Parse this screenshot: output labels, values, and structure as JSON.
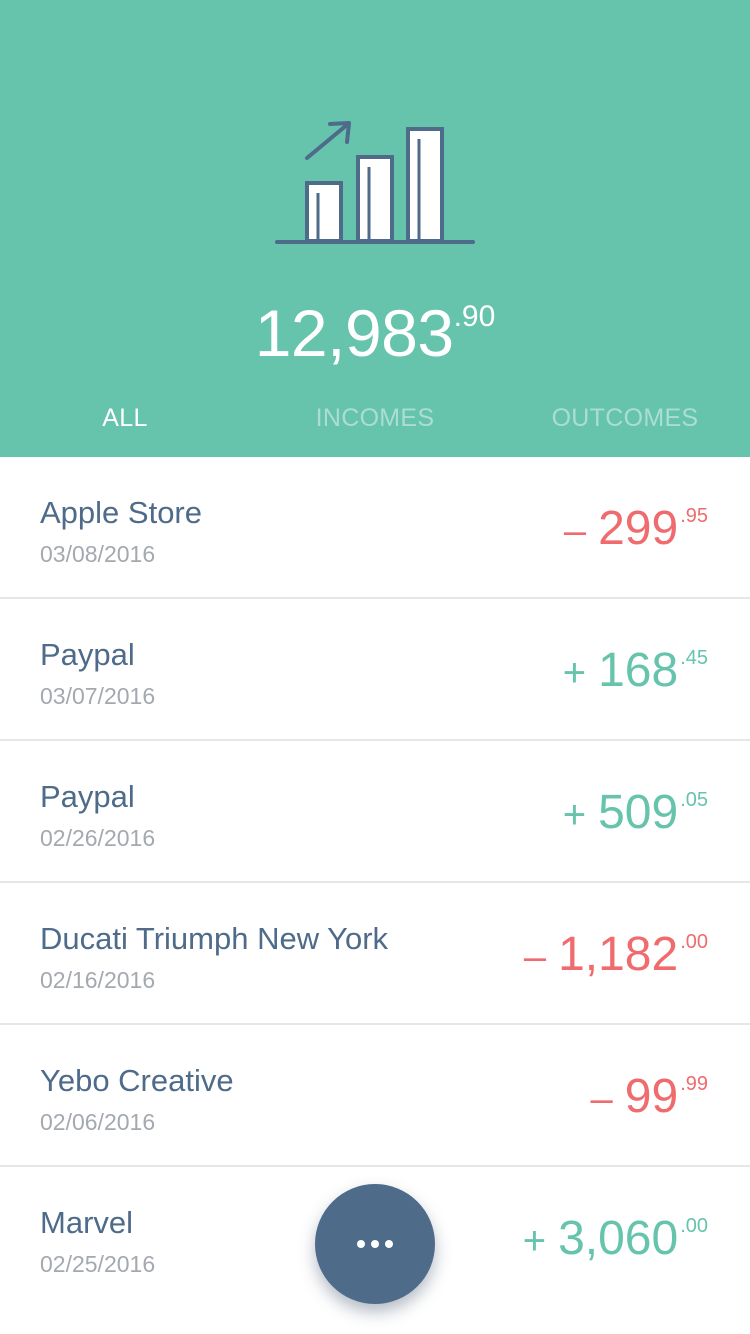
{
  "header": {
    "icon": "bar-chart-growth-icon",
    "balance": {
      "integer": "12,983",
      "decimal": ".90"
    },
    "tabs": [
      {
        "label": "ALL",
        "active": true
      },
      {
        "label": "INCOMES",
        "active": false
      },
      {
        "label": "OUTCOMES",
        "active": false
      }
    ]
  },
  "transactions": [
    {
      "name": "Apple Store",
      "date": "03/08/2016",
      "sign": "–",
      "integer": "299",
      "decimal": ".95",
      "type": "negative"
    },
    {
      "name": "Paypal",
      "date": "03/07/2016",
      "sign": "+",
      "integer": "168",
      "decimal": ".45",
      "type": "positive"
    },
    {
      "name": "Paypal",
      "date": "02/26/2016",
      "sign": "+",
      "integer": "509",
      "decimal": ".05",
      "type": "positive"
    },
    {
      "name": "Ducati Triumph New York",
      "date": "02/16/2016",
      "sign": "–",
      "integer": "1,182",
      "decimal": ".00",
      "type": "negative"
    },
    {
      "name": "Yebo Creative",
      "date": "02/06/2016",
      "sign": "–",
      "integer": "99",
      "decimal": ".99",
      "type": "negative"
    },
    {
      "name": "Marvel",
      "date": "02/25/2016",
      "sign": "+",
      "integer": "3,060",
      "decimal": ".00",
      "type": "positive"
    }
  ],
  "fab": {
    "icon": "more-dots-icon"
  },
  "colors": {
    "accent": "#66c3ac",
    "negative": "#ef6b6e",
    "positive": "#66c3ac",
    "primary_text": "#4e6b8a",
    "secondary_text": "#a4a9b0",
    "fab": "#4e6b8a"
  }
}
